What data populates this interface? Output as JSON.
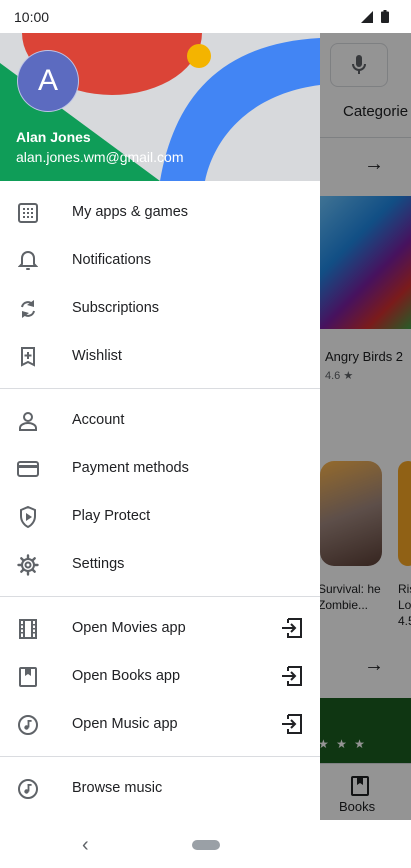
{
  "status_bar": {
    "time": "10:00"
  },
  "background": {
    "tab_label": "Categorie",
    "game1": {
      "title": "Angry Birds 2",
      "rating": "4.6 ★"
    },
    "game2": {
      "title": "Survival: he Zombie..."
    },
    "game3": {
      "title": "Ris Lo 4.5"
    },
    "stars": "★ ★ ★",
    "bottom_nav_label": "Books"
  },
  "drawer": {
    "header": {
      "avatar_letter": "A",
      "name": "Alan Jones",
      "email": "alan.jones.wm@gmail.com"
    },
    "items": [
      {
        "label": "My apps & games",
        "icon": "grid-icon"
      },
      {
        "label": "Notifications",
        "icon": "bell-icon"
      },
      {
        "label": "Subscriptions",
        "icon": "refresh-icon"
      },
      {
        "label": "Wishlist",
        "icon": "bookmark-add-icon"
      },
      {
        "label": "Account",
        "icon": "person-icon"
      },
      {
        "label": "Payment methods",
        "icon": "credit-card-icon"
      },
      {
        "label": "Play Protect",
        "icon": "shield-play-icon"
      },
      {
        "label": "Settings",
        "icon": "gear-icon"
      },
      {
        "label": "Open Movies app",
        "icon": "film-icon"
      },
      {
        "label": "Open Books app",
        "icon": "book-icon"
      },
      {
        "label": "Open Music app",
        "icon": "music-note-icon"
      },
      {
        "label": "Browse music",
        "icon": "music-note-icon"
      }
    ]
  },
  "colors": {
    "avatar": "#5c6bc0",
    "header_red": "#db4437",
    "header_green": "#0f9d58",
    "header_blue": "#4285f4",
    "header_yellow": "#f4b400",
    "text": "#202124",
    "icon": "#5f6368"
  }
}
